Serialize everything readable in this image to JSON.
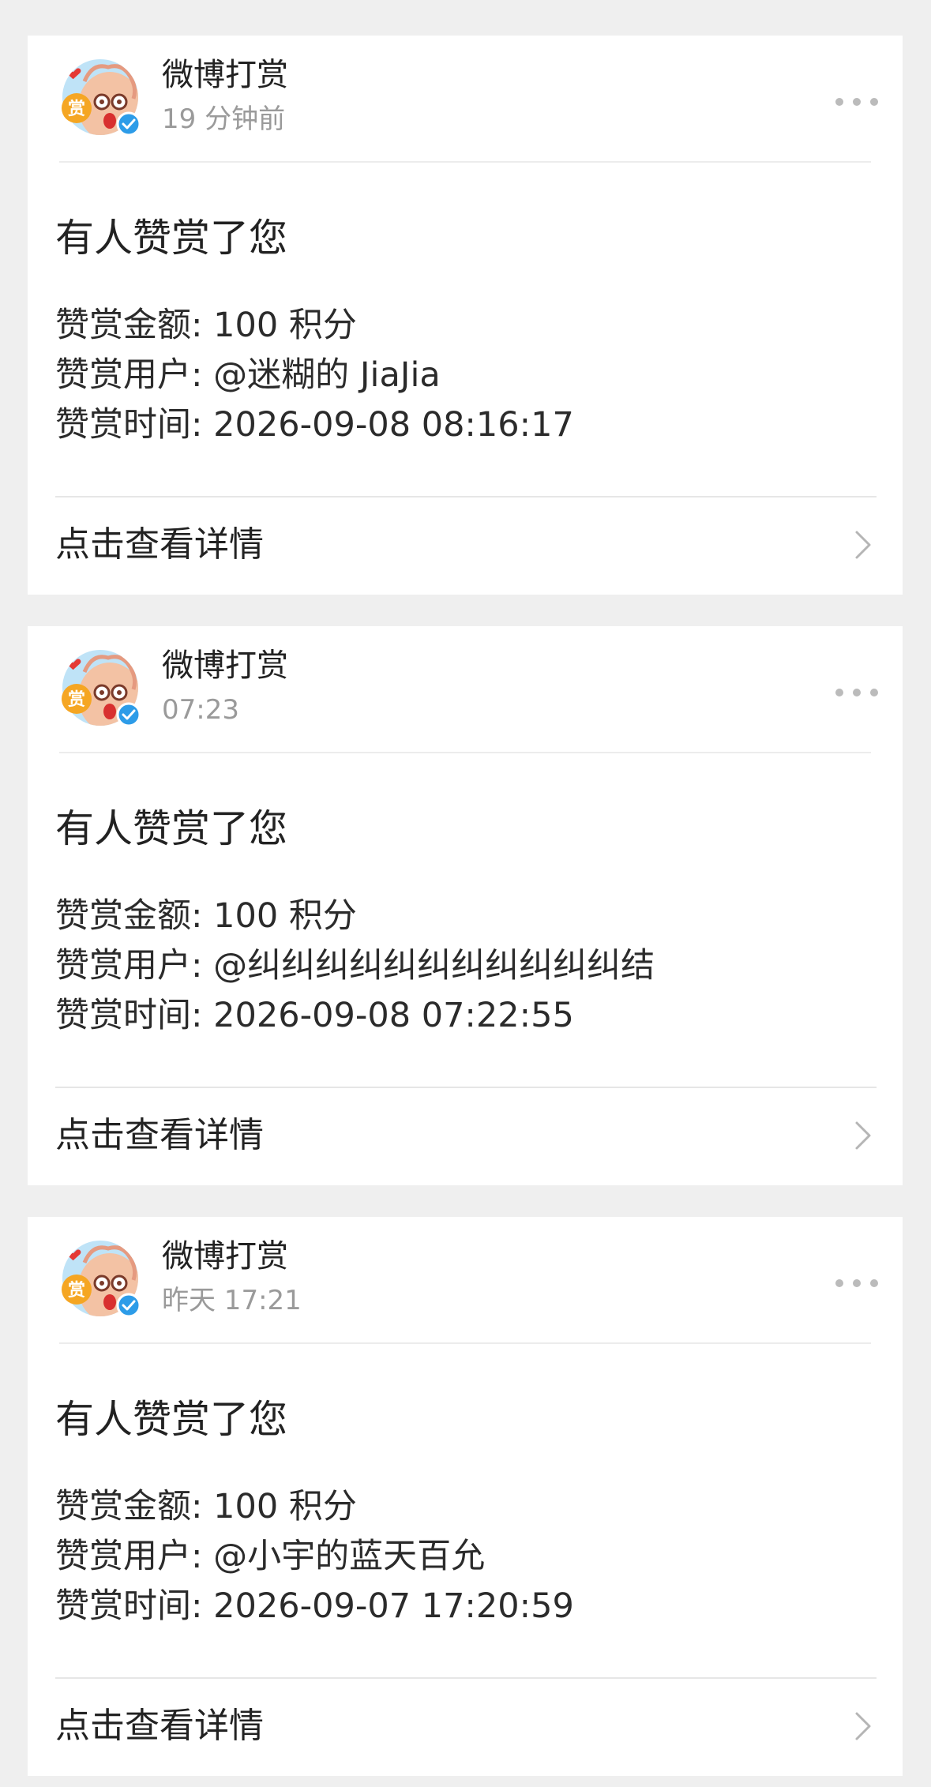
{
  "notifications": [
    {
      "sender": "微博打赏",
      "time": "19 分钟前",
      "headline": "有人赞赏了您",
      "amount": "赞赏金额: 100 积分",
      "user": "赞赏用户: @迷糊的 JiaJia",
      "datetime": "赞赏时间: 2026-09-08 08:16:17",
      "link_label": "点击查看详情"
    },
    {
      "sender": "微博打赏",
      "time": "07:23",
      "headline": "有人赞赏了您",
      "amount": "赞赏金额: 100 积分",
      "user": "赞赏用户: @纠纠纠纠纠纠纠纠纠纠纠结",
      "datetime": "赞赏时间: 2026-09-08 07:22:55",
      "link_label": "点击查看详情"
    },
    {
      "sender": "微博打赏",
      "time": "昨天 17:21",
      "headline": "有人赞赏了您",
      "amount": "赞赏金额: 100 积分",
      "user": "赞赏用户: @小宇的蓝天百允",
      "datetime": "赞赏时间: 2026-09-07 17:20:59",
      "link_label": "点击查看详情"
    }
  ],
  "avatar": {
    "badge_char": "赏",
    "badge_color": "#f5a623",
    "verified_color": "#2d9ce8",
    "verified_icon": "verified-check-icon"
  },
  "colors": {
    "page_background": "#efefef",
    "card_background": "#ffffff",
    "primary_text": "#222222",
    "secondary_text": "#9a9a9a",
    "divider": "#e6e6e6",
    "more_dots": "#bbbbbb"
  },
  "icons": {
    "more": "more-dots-icon",
    "chevron": "chevron-right-icon"
  }
}
